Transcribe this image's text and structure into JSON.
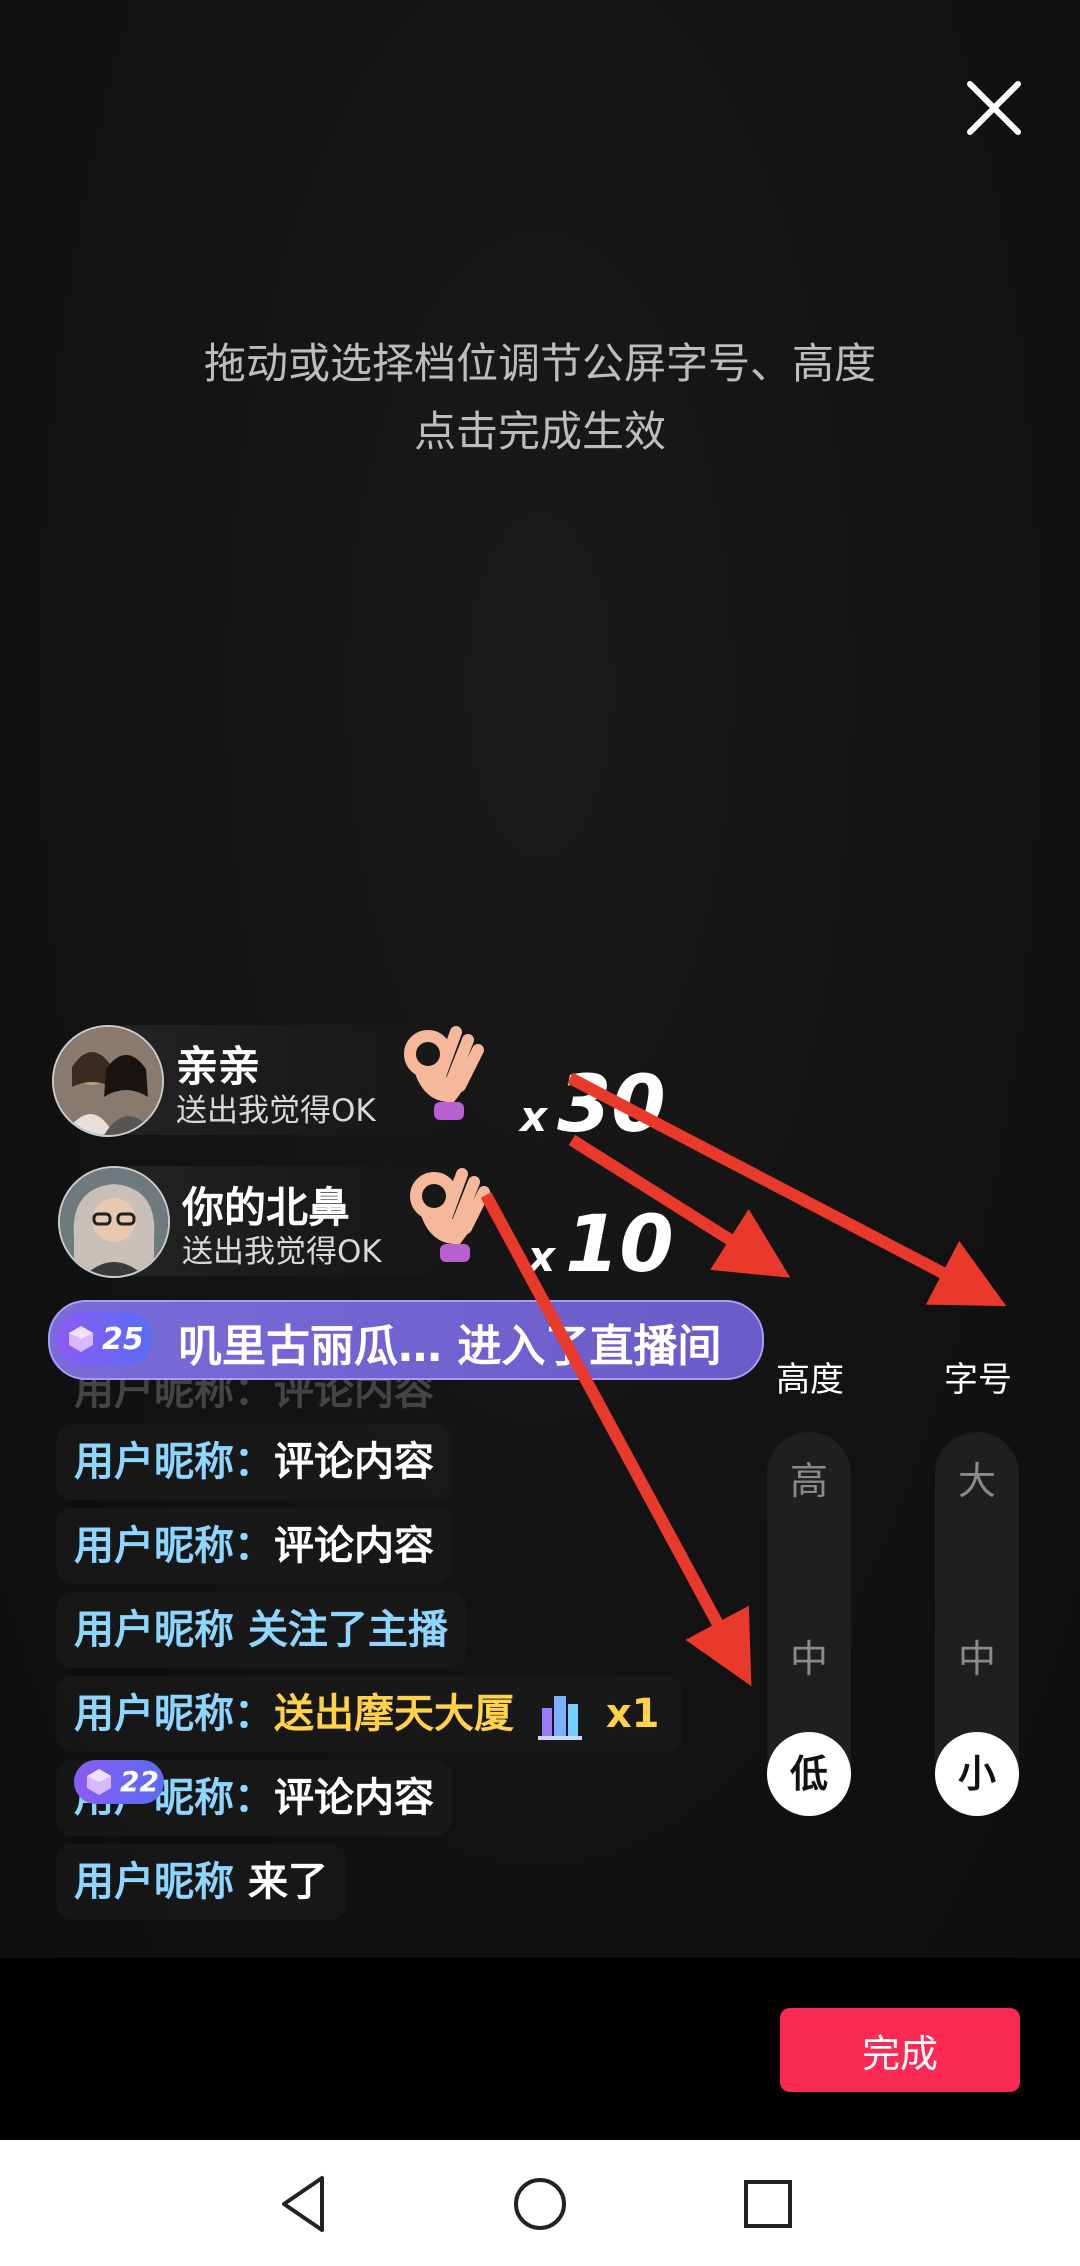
{
  "overlay": {
    "hint_line1": "拖动或选择档位调节公屏字号、高度",
    "hint_line2": "点击完成生效"
  },
  "gifts": [
    {
      "name": "亲亲",
      "action": "送出我觉得OK",
      "combo_prefix": "x",
      "combo_count": "30",
      "gift_icon": "ok-hand-icon"
    },
    {
      "name": "你的北鼻",
      "action": "送出我觉得OK",
      "combo_prefix": "x",
      "combo_count": "10",
      "gift_icon": "ok-hand-icon"
    }
  ],
  "enter_banner": {
    "level": "25",
    "text": "叽里古丽瓜… 进入了直播间"
  },
  "ghost_comment": "用户昵称：评论内容",
  "comments": [
    {
      "nick": "用户昵称：",
      "text": "评论内容"
    },
    {
      "nick": "用户昵称：",
      "text": "评论内容"
    },
    {
      "nick": "用户昵称 ",
      "text": "关注了主播"
    },
    {
      "nick": "用户昵称：",
      "text": "送出摩天大厦",
      "gift_icon": "skyscraper-icon",
      "count": "x1"
    },
    {
      "level": "22",
      "nick": "用户昵称：",
      "text": "评论内容"
    },
    {
      "nick": "用户昵称 ",
      "text": "来了"
    }
  ],
  "controls": {
    "height": {
      "title": "高度",
      "levels": [
        "高",
        "中",
        "低"
      ],
      "selected": "低"
    },
    "font_size": {
      "title": "字号",
      "levels": [
        "大",
        "中",
        "小"
      ],
      "selected": "小"
    }
  },
  "done_button": "完成",
  "colors": {
    "accent": "#fa2a55",
    "nickname": "#8fd6ff",
    "gift_text": "#ffd24a",
    "arrow": "#e8392b"
  }
}
